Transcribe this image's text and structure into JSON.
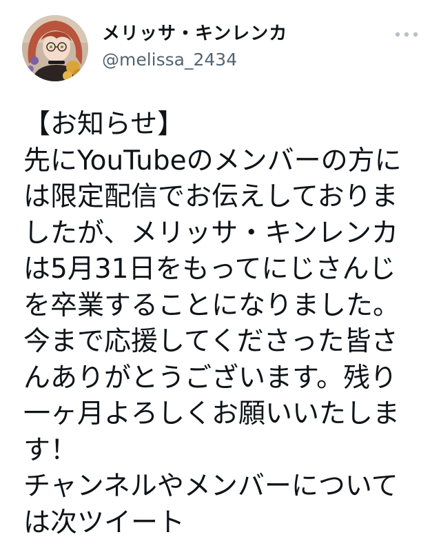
{
  "user": {
    "display_name": "メリッサ・キンレンカ",
    "handle": "@melissa_2434",
    "avatar_icon": "profile-avatar"
  },
  "more_icon": "more-options-icon",
  "tweet": {
    "lines": [
      "【お知らせ】",
      "先にYouTubeのメンバーの方に",
      "は限定配信でお伝えしておりま",
      "したが、メリッサ・キンレンカ",
      "は5月31日をもってにじさんじ",
      "を卒業することになりました。",
      "今まで応援してくださった皆さ",
      "んありがとうございます。残り",
      "一ヶ月よろしくお願いいたしま",
      "す！",
      "チャンネルやメンバーについて",
      "は次ツイート"
    ]
  },
  "colors": {
    "text": "#0f1419",
    "secondary_text": "#536471",
    "background": "#ffffff",
    "more_icon": "#b9c0c6"
  }
}
